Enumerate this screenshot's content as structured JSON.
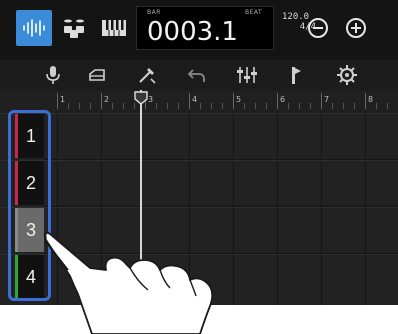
{
  "header": {
    "bar_label": "BAR",
    "beat_label": "BEAT",
    "position": "0003.1",
    "tempo": "120.0",
    "time_signature": "4/4"
  },
  "header_icons": [
    "audio-waveform-icon",
    "drum-icon",
    "keyboard-icon",
    "zoom-out-icon",
    "zoom-in-icon"
  ],
  "toolbar": [
    "microphone-icon",
    "eraser-icon",
    "tools-icon",
    "undo-icon",
    "mixer-icon",
    "marker-icon",
    "settings-icon"
  ],
  "ruler": {
    "bars": [
      "1",
      "2",
      "3",
      "4",
      "5",
      "6",
      "7",
      "8"
    ]
  },
  "tracks": [
    {
      "label": "1",
      "color": "#c8284a",
      "selected": false
    },
    {
      "label": "2",
      "color": "#c8284a",
      "selected": false
    },
    {
      "label": "3",
      "color": "#8a8a8a",
      "selected": true
    },
    {
      "label": "4",
      "color": "#2fa830",
      "selected": false
    }
  ],
  "colors": {
    "accent": "#3a8cd8",
    "highlight": "#3b6fd4",
    "background": "#1a1a1a"
  }
}
